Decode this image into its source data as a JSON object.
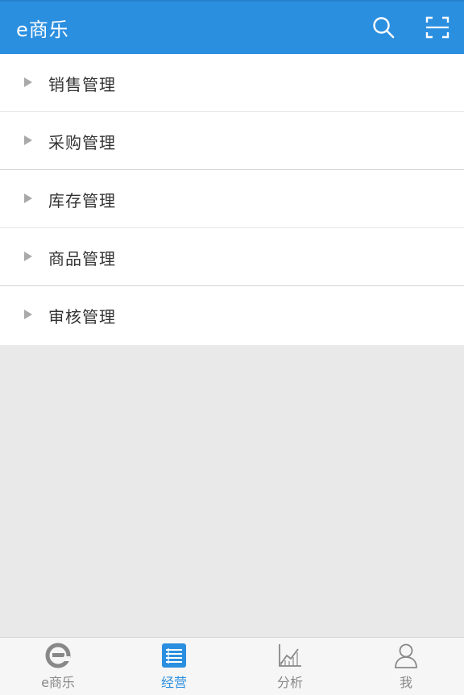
{
  "header": {
    "title": "e商乐",
    "search_icon": "search-icon",
    "scan_icon": "scan-icon",
    "accent": "#2b8fe0"
  },
  "menu": {
    "items": [
      {
        "label": "销售管理"
      },
      {
        "label": "采购管理"
      },
      {
        "label": "库存管理"
      },
      {
        "label": "商品管理"
      },
      {
        "label": "审核管理"
      }
    ]
  },
  "tabs": [
    {
      "label": "e商乐",
      "icon": "e-logo-icon",
      "active": false
    },
    {
      "label": "经营",
      "icon": "list-icon",
      "active": true
    },
    {
      "label": "分析",
      "icon": "chart-icon",
      "active": false
    },
    {
      "label": "我",
      "icon": "user-icon",
      "active": false
    }
  ],
  "colors": {
    "tab_active": "#2b8fe0",
    "tab_inactive": "#888888",
    "background": "#e9e9e9"
  }
}
